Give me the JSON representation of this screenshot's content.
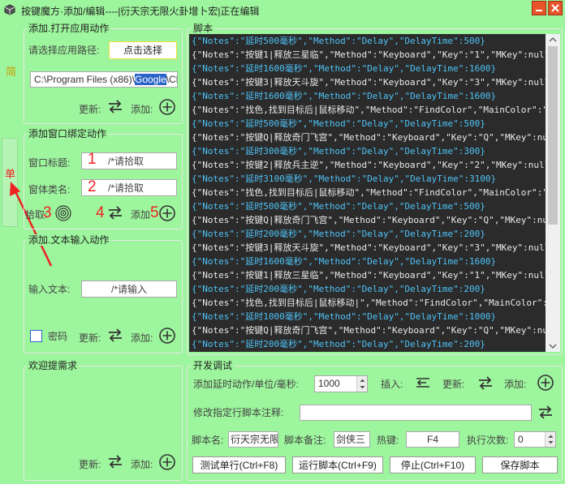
{
  "window": {
    "title": "按键魔方·添加/编辑----|衍天宗无限火卦增卜宏|正在编辑"
  },
  "side_tab": {
    "top_label": "简",
    "bottom_label": "单"
  },
  "open_app": {
    "legend": "添加.打开应用动作",
    "path_label": "请选择应用路径:",
    "choose_button": "点击选择",
    "path_value_before": "C:\\Program Files (x86)\\",
    "path_value_selected": "Google",
    "path_value_after": "\\Chrome",
    "update_label": "更新:",
    "add_label": "添加:"
  },
  "window_bind": {
    "legend": "添加窗口绑定动作",
    "title_label": "窗口标题:",
    "title_placeholder": "/*请拾取",
    "class_label": "窗体类名:",
    "class_placeholder": "/*请拾取",
    "pick_label": "拾取:",
    "update_label": "更新",
    "add_label": "添加",
    "marks": [
      "1",
      "2",
      "3",
      "4",
      "5"
    ]
  },
  "text_input": {
    "legend": "添加.文本输入动作",
    "input_label": "输入文本:",
    "input_placeholder": "/*请输入",
    "password_label": "密码",
    "update_label": "更新:",
    "add_label": "添加:"
  },
  "welcome": {
    "legend": "欢迎提需求",
    "update_label": "更新:",
    "add_label": "添加:"
  },
  "script": {
    "legend": "脚本",
    "lines": [
      {
        "kind": "delay",
        "text": "{\"Notes\":\"延时500毫秒\",\"Method\":\"Delay\",\"DelayTime\":500}"
      },
      {
        "kind": "action",
        "text": "{\"Notes\":\"按键1|释放三星临\",\"Method\":\"Keyboard\",\"Key\":\"1\",\"MKey\":null,"
      },
      {
        "kind": "delay",
        "text": "{\"Notes\":\"延时1600毫秒\",\"Method\":\"Delay\",\"DelayTime\":1600}"
      },
      {
        "kind": "action",
        "text": "{\"Notes\":\"按键3|释放天斗旋\",\"Method\":\"Keyboard\",\"Key\":\"3\",\"MKey\":null,"
      },
      {
        "kind": "delay",
        "text": "{\"Notes\":\"延时1600毫秒\",\"Method\":\"Delay\",\"DelayTime\":1600}"
      },
      {
        "kind": "action",
        "text": "{\"Notes\":\"找色,找到目标后|鼠标移动\",\"Method\":\"FindColor\",\"MainColor\":\""
      },
      {
        "kind": "delay",
        "text": "{\"Notes\":\"延时500毫秒\",\"Method\":\"Delay\",\"DelayTime\":500}"
      },
      {
        "kind": "action",
        "text": "{\"Notes\":\"按键Q|释放奇门飞宫\",\"Method\":\"Keyboard\",\"Key\":\"Q\",\"MKey\":nul"
      },
      {
        "kind": "delay",
        "text": "{\"Notes\":\"延时300毫秒\",\"Method\":\"Delay\",\"DelayTime\":300}"
      },
      {
        "kind": "action",
        "text": "{\"Notes\":\"按键2|释放兵主逆\",\"Method\":\"Keyboard\",\"Key\":\"2\",\"MKey\":null,"
      },
      {
        "kind": "delay",
        "text": "{\"Notes\":\"延时3100毫秒\",\"Method\":\"Delay\",\"DelayTime\":3100}"
      },
      {
        "kind": "action",
        "text": "{\"Notes\":\"找色,找到目标后|鼠标移动\",\"Method\":\"FindColor\",\"MainColor\":\""
      },
      {
        "kind": "delay",
        "text": "{\"Notes\":\"延时500毫秒\",\"Method\":\"Delay\",\"DelayTime\":500}"
      },
      {
        "kind": "action",
        "text": "{\"Notes\":\"按键Q|释放奇门飞宫\",\"Method\":\"Keyboard\",\"Key\":\"Q\",\"MKey\":nul"
      },
      {
        "kind": "delay",
        "text": "{\"Notes\":\"延时200毫秒\",\"Method\":\"Delay\",\"DelayTime\":200}"
      },
      {
        "kind": "action",
        "text": "{\"Notes\":\"按键3|释放天斗旋\",\"Method\":\"Keyboard\",\"Key\":\"3\",\"MKey\":null,"
      },
      {
        "kind": "delay",
        "text": "{\"Notes\":\"延时1600毫秒\",\"Method\":\"Delay\",\"DelayTime\":1600}"
      },
      {
        "kind": "action",
        "text": "{\"Notes\":\"按键1|释放三星临\",\"Method\":\"Keyboard\",\"Key\":\"1\",\"MKey\":null,"
      },
      {
        "kind": "delay",
        "text": "{\"Notes\":\"延时200毫秒\",\"Method\":\"Delay\",\"DelayTime\":200}"
      },
      {
        "kind": "action",
        "text": "{\"Notes\":\"找色,找到目标后|鼠标移动|\",\"Method\":\"FindColor\",\"MainColor\":"
      },
      {
        "kind": "delay",
        "text": "{\"Notes\":\"延时1000毫秒\",\"Method\":\"Delay\",\"DelayTime\":1000}"
      },
      {
        "kind": "action",
        "text": "{\"Notes\":\"按键Q|释放奇门飞宫\",\"Method\":\"Keyboard\",\"Key\":\"Q\",\"MKey\":nul"
      },
      {
        "kind": "delay",
        "text": "{\"Notes\":\"延时200毫秒\",\"Method\":\"Delay\",\"DelayTime\":200}"
      }
    ]
  },
  "dev": {
    "legend": "开发调试",
    "delay_label": "添加延时动作/单位/毫秒:",
    "delay_value": "1000",
    "insert_label": "插入:",
    "update_label": "更新:",
    "add_label": "添加:",
    "modify_label": "修改指定行脚本注释:",
    "script_name_label": "脚本名:",
    "script_name_value": "衍天宗无限",
    "script_note_label": "脚本备注:",
    "script_note_value": "剑侠三",
    "hotkey_label": "热键:",
    "hotkey_value": "F4",
    "exec_count_label": "执行次数:",
    "exec_count_value": "0",
    "test_button": "测试单行(Ctrl+F8)",
    "run_button": "运行脚本(Ctrl+F9)",
    "stop_button": "停止(Ctrl+F10)",
    "save_button": "保存脚本"
  }
}
